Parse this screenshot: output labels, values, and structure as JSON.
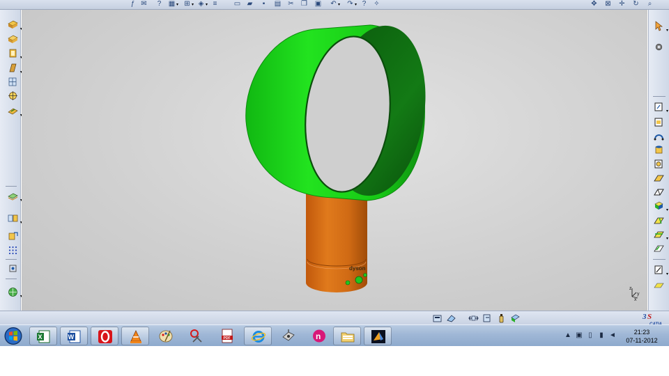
{
  "app": {
    "name": "CATIA",
    "logo_text": "CATIA"
  },
  "colors": {
    "ring_outer": "#1fd61c",
    "ring_inner": "#0f6a10",
    "base": "#d46b14",
    "base_shadow": "#a04c08",
    "buttons": "#22c420",
    "viewport_bg": "#d2d2d2"
  },
  "model": {
    "description_badge": "dyson",
    "compass": {
      "z": "z",
      "x": "x",
      "y": "y"
    }
  },
  "top_toolbar": {
    "icons": [
      "formula-icon",
      "comment-icon",
      "question-icon",
      "table-icon",
      "tree-icon",
      "cube-icon",
      "macro-icon",
      "new-file-icon",
      "open-file-icon",
      "save-icon",
      "print-icon",
      "cut-icon",
      "copy-icon",
      "paste-icon",
      "undo-icon",
      "redo-icon",
      "whats-this-icon",
      "pan-icon",
      "fit-all-icon",
      "move-icon",
      "rotate-icon",
      "zoom-icon"
    ]
  },
  "taskbar": {
    "apps": [
      "excel",
      "word",
      "opera",
      "vlc",
      "paint",
      "snipping-tool",
      "pdf",
      "internet-explorer",
      "scanner",
      "nero",
      "folder",
      "catia"
    ],
    "active_app": "catia"
  },
  "clock": {
    "time": "21:23",
    "date": "07-11-2012"
  }
}
